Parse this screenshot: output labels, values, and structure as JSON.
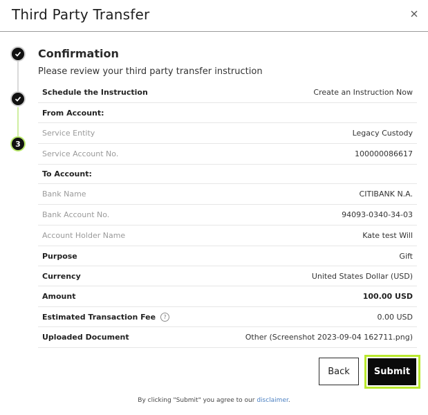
{
  "dialog": {
    "title": "Third Party Transfer",
    "close_icon": "close-icon"
  },
  "stepper": {
    "steps": [
      {
        "state": "done",
        "icon": "check-icon"
      },
      {
        "state": "done",
        "icon": "check-icon"
      },
      {
        "state": "current",
        "label": "3"
      }
    ]
  },
  "confirmation": {
    "title": "Confirmation",
    "subtitle": "Please review your third party transfer instruction"
  },
  "rows": [
    {
      "label": "Schedule the Instruction",
      "value": "Create an Instruction Now",
      "style": "main"
    },
    {
      "label": "From Account:",
      "value": "",
      "style": "group"
    },
    {
      "label": "Service Entity",
      "value": "Legacy Custody",
      "style": "sub"
    },
    {
      "label": "Service Account No.",
      "value": "100000086617",
      "style": "sub"
    },
    {
      "label": "To Account:",
      "value": "",
      "style": "group"
    },
    {
      "label": "Bank Name",
      "value": "CITIBANK N.A.",
      "style": "sub"
    },
    {
      "label": "Bank Account No.",
      "value": "94093-0340-34-03",
      "style": "sub"
    },
    {
      "label": "Account Holder Name",
      "value": "Kate test Will",
      "style": "sub"
    },
    {
      "label": "Purpose",
      "value": "Gift",
      "style": "main"
    },
    {
      "label": "Currency",
      "value": "United States Dollar (USD)",
      "style": "main"
    },
    {
      "label": "Amount",
      "value": "100.00 USD",
      "style": "strong"
    },
    {
      "label": "Estimated Transaction Fee",
      "value": "0.00 USD",
      "style": "main",
      "info": "?"
    },
    {
      "label": "Uploaded Document",
      "value": "Other (Screenshot 2023-09-04 162711.png)",
      "style": "main"
    }
  ],
  "actions": {
    "back_label": "Back",
    "submit_label": "Submit"
  },
  "footer": {
    "prefix": "By clicking \"Submit\" you agree to our ",
    "link": "disclaimer",
    "suffix": "."
  },
  "colors": {
    "accent": "#b9e82d",
    "link": "#4a7fc1",
    "primary_button": "#0a0a0a"
  }
}
